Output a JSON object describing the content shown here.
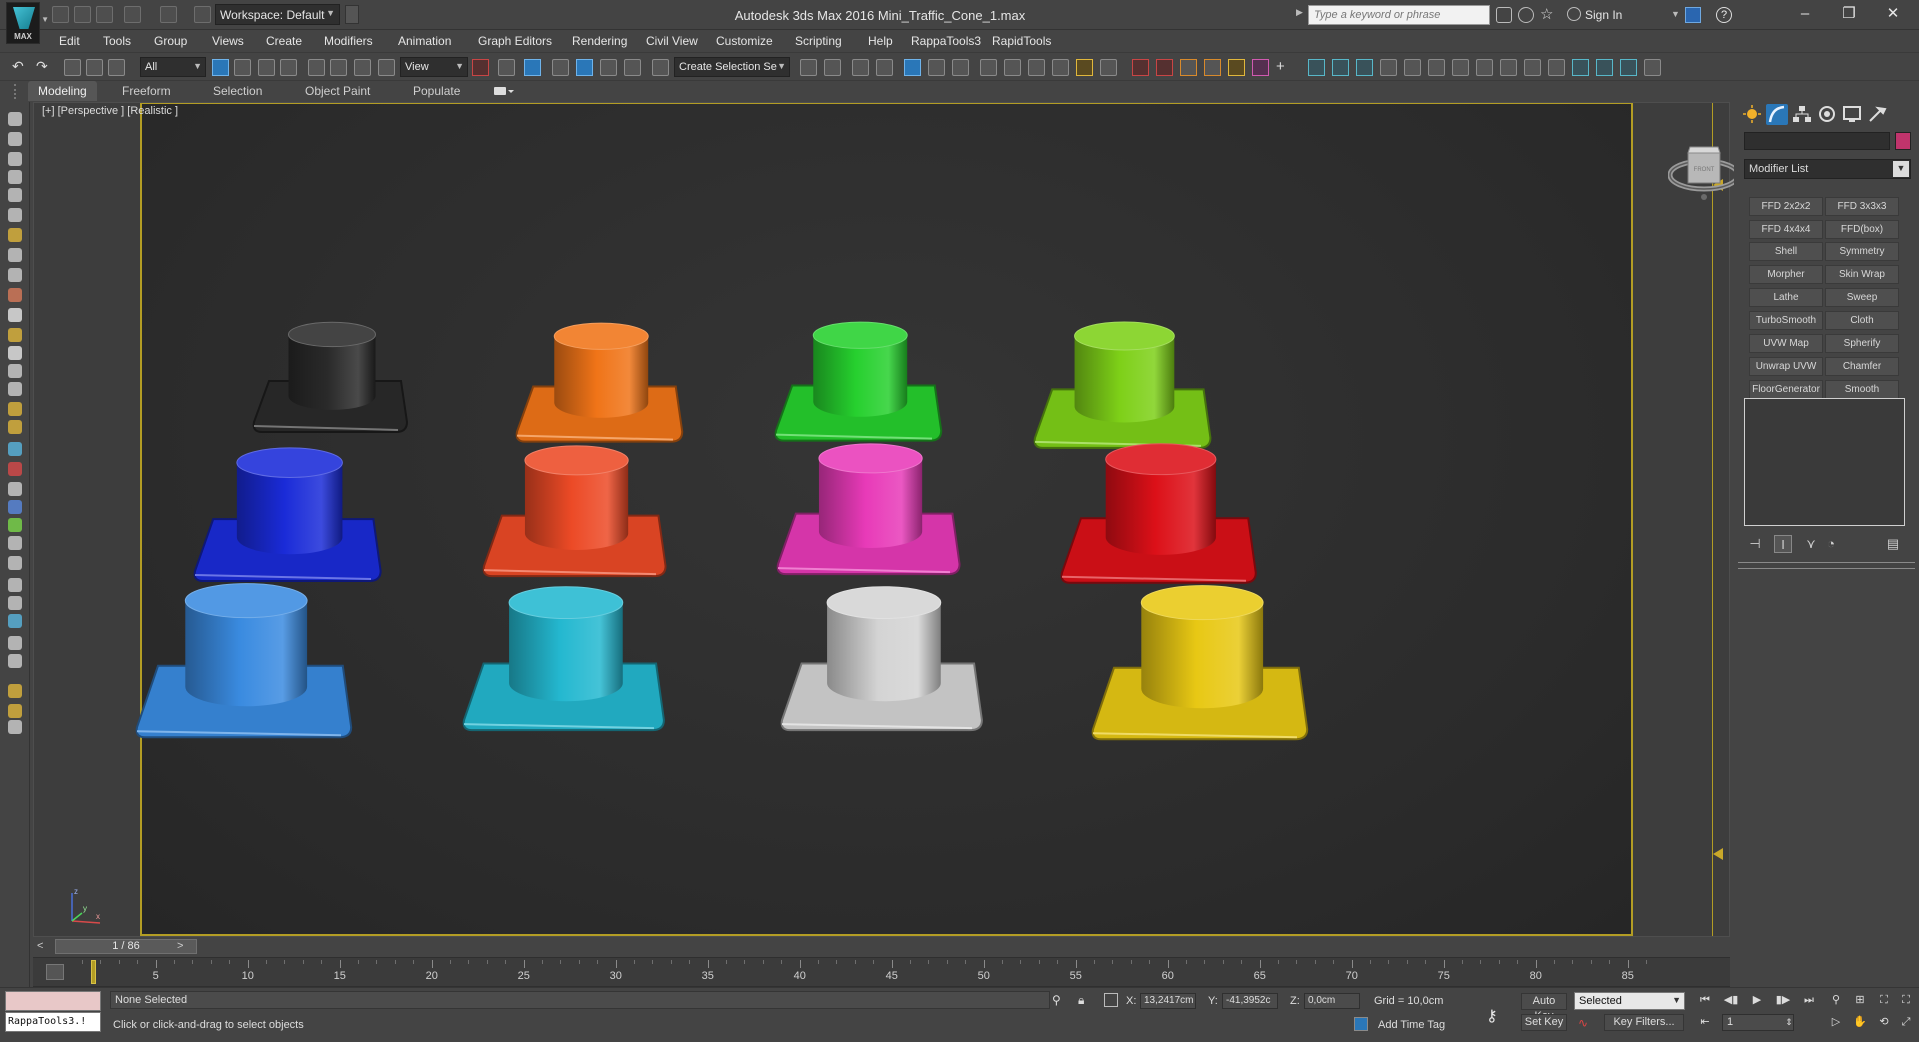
{
  "app": {
    "title": "Autodesk 3ds Max 2016      Mini_Traffic_Cone_1.max",
    "logo_label": "MAX",
    "workspace": "Workspace: Default",
    "search_placeholder": "Type a keyword or phrase",
    "signin_label": "Sign In"
  },
  "menu": [
    "Edit",
    "Tools",
    "Group",
    "Views",
    "Create",
    "Modifiers",
    "Animation",
    "Graph Editors",
    "Rendering",
    "Civil View",
    "Customize",
    "Scripting",
    "Help",
    "RappaTools3",
    "RapidTools"
  ],
  "toolbar": {
    "selection_filter": "All",
    "reference_coordinate": "View",
    "named_selection": "Create Selection Se"
  },
  "ribbon": {
    "tabs": [
      "Modeling",
      "Freeform",
      "Selection",
      "Object Paint",
      "Populate"
    ],
    "active_tab": "Modeling"
  },
  "viewport": {
    "label": "[+] [Perspective ] [Realistic ]",
    "viewcube_label": "FRONT",
    "axis_labels": [
      "z",
      "x",
      "y"
    ],
    "objects": [
      {
        "name": "cone-black",
        "color": "#2a2a2a"
      },
      {
        "name": "cone-orange",
        "color": "#f07418"
      },
      {
        "name": "cone-green",
        "color": "#26d02e"
      },
      {
        "name": "cone-lime",
        "color": "#7ed018"
      },
      {
        "name": "cone-blue",
        "color": "#1a2bd8"
      },
      {
        "name": "cone-red-orange",
        "color": "#ec4a26"
      },
      {
        "name": "cone-pink",
        "color": "#e83ab8"
      },
      {
        "name": "cone-red",
        "color": "#dc1018"
      },
      {
        "name": "cone-light-blue",
        "color": "#3a8be0"
      },
      {
        "name": "cone-cyan",
        "color": "#24b8d0"
      },
      {
        "name": "cone-white",
        "color": "#d4d4d4"
      },
      {
        "name": "cone-yellow",
        "color": "#e8c814"
      }
    ]
  },
  "timeline": {
    "slider_label": "1 / 86",
    "tick_labels": [
      "5",
      "10",
      "15",
      "20",
      "25",
      "30",
      "35",
      "40",
      "45",
      "50",
      "55",
      "60",
      "65",
      "70",
      "75",
      "80",
      "85"
    ],
    "current_frame": 1,
    "total_frames": 86
  },
  "command_panel": {
    "modifier_list_label": "Modifier List",
    "selection_color": "#c0346c",
    "modifier_buttons": [
      [
        "FFD 2x2x2",
        "FFD 3x3x3"
      ],
      [
        "FFD 4x4x4",
        "FFD(box)"
      ],
      [
        "Shell",
        "Symmetry"
      ],
      [
        "Morpher",
        "Skin Wrap"
      ],
      [
        "Lathe",
        "Sweep"
      ],
      [
        "TurboSmooth",
        "Cloth"
      ],
      [
        "UVW Map",
        "Spherify"
      ],
      [
        "Unwrap UVW",
        "Chamfer"
      ],
      [
        "FloorGenerator",
        "Smooth"
      ]
    ]
  },
  "status": {
    "maxscript_text": "RappaTools3.!",
    "selection_status": "None Selected",
    "prompt": "Click or click-and-drag to select objects",
    "x_label": "X:",
    "x_value": "13,2417cm",
    "y_label": "Y:",
    "y_value": "-41,3952c",
    "z_label": "Z:",
    "z_value": "0,0cm",
    "grid": "Grid = 10,0cm",
    "add_time_tag": "Add Time Tag",
    "auto_key": "Auto Key",
    "set_key": "Set Key",
    "key_mode": "Selected",
    "key_filters": "Key Filters...",
    "frame_value": "1"
  }
}
